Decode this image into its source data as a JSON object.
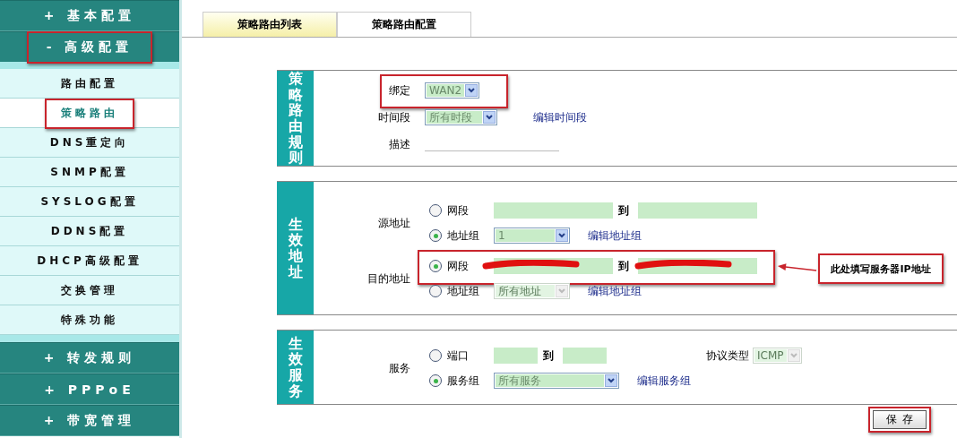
{
  "sidebar": {
    "groups": [
      {
        "label": "+ 基本配置",
        "expanded": false,
        "annotated": false
      },
      {
        "label": "- 高级配置",
        "expanded": true,
        "annotated": true,
        "children": [
          {
            "label": "路由配置",
            "selected": false,
            "annotated": false
          },
          {
            "label": "策略路由",
            "selected": true,
            "annotated": true
          },
          {
            "label": "DNS重定向",
            "selected": false,
            "annotated": false
          },
          {
            "label": "SNMP配置",
            "selected": false,
            "annotated": false
          },
          {
            "label": "SYSLOG配置",
            "selected": false,
            "annotated": false
          },
          {
            "label": "DDNS配置",
            "selected": false,
            "annotated": false
          },
          {
            "label": "DHCP高级配置",
            "selected": false,
            "annotated": false
          },
          {
            "label": "交换管理",
            "selected": false,
            "annotated": false
          },
          {
            "label": "特殊功能",
            "selected": false,
            "annotated": false
          }
        ]
      },
      {
        "label": "+ 转发规则",
        "expanded": false,
        "annotated": false
      },
      {
        "label": "+ PPPoE",
        "expanded": false,
        "annotated": false
      },
      {
        "label": "+ 带宽管理",
        "expanded": false,
        "annotated": false
      }
    ]
  },
  "tabs": [
    {
      "label": "策略路由列表",
      "selected": false
    },
    {
      "label": "策略路由配置",
      "selected": true
    }
  ],
  "sections": [
    {
      "title": "策略路由规则",
      "fields": [
        {
          "kind": "select",
          "label": "绑定",
          "value": "WAN2",
          "annotated": true
        },
        {
          "kind": "select",
          "label": "时间段",
          "value": "所有时段",
          "link": "编辑时间段",
          "annotated": false
        },
        {
          "kind": "line",
          "label": "描述"
        }
      ]
    },
    {
      "title": "生效地址",
      "fields": [
        {
          "kind": "radio-group",
          "label": "源地址",
          "options": [
            {
              "kind": "range",
              "label": "网段",
              "selected": false,
              "separator": "到",
              "redacted": false,
              "annotated": false
            },
            {
              "kind": "select",
              "label": "地址组",
              "selected": true,
              "value": "1",
              "disabled": false,
              "link": "编辑地址组"
            }
          ]
        },
        {
          "kind": "radio-group",
          "label": "目的地址",
          "options": [
            {
              "kind": "range",
              "label": "网段",
              "selected": true,
              "separator": "到",
              "redacted": true,
              "annotated": true,
              "callout": "此处填写服务器IP地址"
            },
            {
              "kind": "select",
              "label": "地址组",
              "selected": false,
              "value": "所有地址",
              "disabled": true,
              "link": "编辑地址组"
            }
          ]
        }
      ]
    },
    {
      "title": "生效服务",
      "fields": [
        {
          "kind": "radio-group",
          "label": "服务",
          "options": [
            {
              "kind": "range",
              "label": "端口",
              "selected": false,
              "separator": "到",
              "redacted": false,
              "annotated": false,
              "narrow": true,
              "extra": {
                "label": "协议类型",
                "value": "ICMP",
                "disabled": true
              }
            },
            {
              "kind": "select",
              "label": "服务组",
              "selected": true,
              "value": "所有服务",
              "disabled": false,
              "link": "编辑服务组",
              "wide": true
            }
          ]
        }
      ]
    }
  ],
  "save_button": {
    "label": "保存",
    "annotated": true
  }
}
